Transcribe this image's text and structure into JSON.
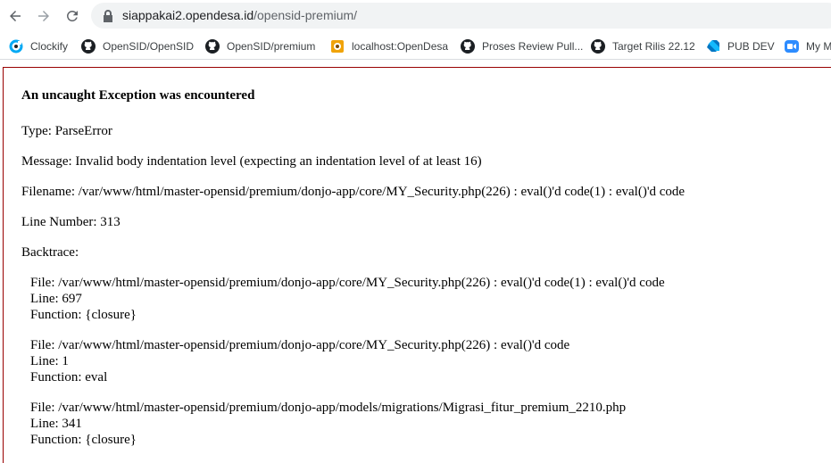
{
  "browser": {
    "url_host": "siappakai2.opendesa.id",
    "url_path": "/opensid-premium/",
    "bookmarks": [
      {
        "label": "Clockify",
        "icon": "clockify-icon",
        "color": "#03a9f4"
      },
      {
        "label": "OpenSID/OpenSID",
        "icon": "github-icon"
      },
      {
        "label": "OpenSID/premium",
        "icon": "github-icon"
      },
      {
        "label": "localhost:OpenDesa",
        "icon": "opendesa-icon"
      },
      {
        "label": "Proses Review Pull...",
        "icon": "github-icon"
      },
      {
        "label": "Target Rilis 22.12",
        "icon": "github-icon"
      },
      {
        "label": "PUB DEV",
        "icon": "dart-icon"
      },
      {
        "label": "My M",
        "icon": "zoom-icon"
      }
    ]
  },
  "error": {
    "title": "An uncaught Exception was encountered",
    "type": "Type: ParseError",
    "message": "Message: Invalid body indentation level (expecting an indentation level of at least 16)",
    "filename": "Filename: /var/www/html/master-opensid/premium/donjo-app/core/MY_Security.php(226) : eval()'d code(1) : eval()'d code",
    "line_number": "Line Number: 313",
    "backtrace_label": "Backtrace:",
    "backtrace": [
      {
        "file": "File: /var/www/html/master-opensid/premium/donjo-app/core/MY_Security.php(226) : eval()'d code(1) : eval()'d code",
        "line": "Line: 697",
        "function": "Function: {closure}"
      },
      {
        "file": "File: /var/www/html/master-opensid/premium/donjo-app/core/MY_Security.php(226) : eval()'d code",
        "line": "Line: 1",
        "function": "Function: eval"
      },
      {
        "file": "File: /var/www/html/master-opensid/premium/donjo-app/models/migrations/Migrasi_fitur_premium_2210.php",
        "line": "Line: 341",
        "function": "Function: {closure}"
      }
    ]
  }
}
